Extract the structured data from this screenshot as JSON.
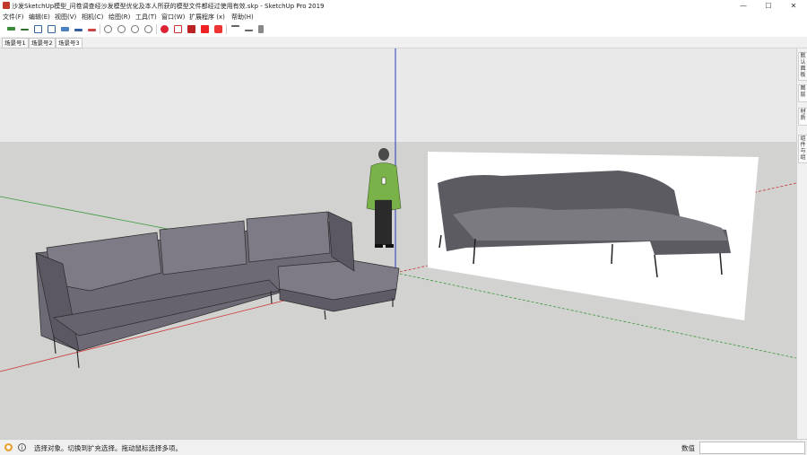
{
  "window": {
    "title": "沙发SketchUp模型_问卷调查经沙发模型优化及本人所获的模型文件都经过使用有效.skp - SketchUp Pro 2019",
    "min_glyph": "—",
    "max_glyph": "☐",
    "close_glyph": "✕"
  },
  "menu": {
    "items": [
      "文件(F)",
      "编辑(E)",
      "视图(V)",
      "相机(C)",
      "绘图(R)",
      "工具(T)",
      "窗口(W)",
      "扩展程序 (x)",
      "帮助(H)"
    ]
  },
  "toolbar": {
    "icons": [
      "line-tool",
      "rect-tool",
      "push-pull",
      "move",
      "rotate",
      "scale",
      "offset",
      "orbit",
      "pan",
      "zoom",
      "zoom-extents",
      "components",
      "materials",
      "warehouse",
      "extension-warehouse",
      "sections",
      "styles",
      "shadows"
    ]
  },
  "scenes": {
    "tabs": [
      "场景号1",
      "场景号2",
      "场景号3"
    ],
    "active_index": 2
  },
  "right_panel": {
    "items": [
      "默认面板",
      "图层",
      "材质",
      "组件与组"
    ]
  },
  "status": {
    "message": "选择对象。切换到扩充选择。拖动鼠标选择多项。",
    "measurements_label": "数值",
    "measurements_value": ""
  },
  "colors": {
    "sky": "#e9e9e9",
    "ground": "#d2d2d0",
    "sofa_fill": "#6e6a75",
    "brand_red": "#c0392b"
  }
}
